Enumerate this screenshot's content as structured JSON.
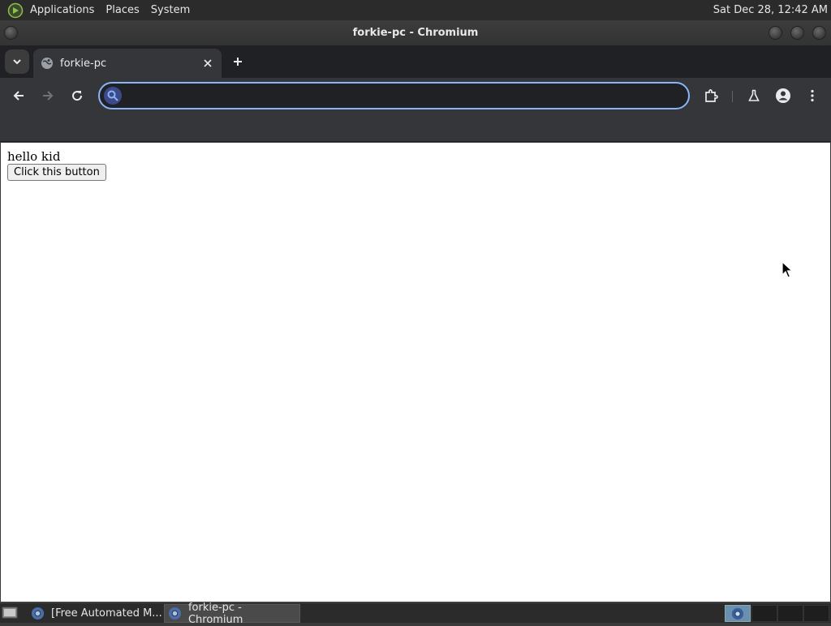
{
  "top_panel": {
    "menus": [
      "Applications",
      "Places",
      "System"
    ],
    "clock": "Sat Dec 28, 12:42 AM"
  },
  "window": {
    "title": "forkie-pc - Chromium"
  },
  "tabs": [
    {
      "title": "forkie-pc",
      "favicon": "globe-icon"
    }
  ],
  "toolbar": {
    "omnibox_value": "",
    "icons": [
      "back-icon",
      "forward-icon",
      "reload-icon",
      "extensions-icon",
      "labs-icon",
      "profile-icon",
      "menu-icon"
    ]
  },
  "page": {
    "greeting": "hello kid",
    "button_label": "Click this button"
  },
  "taskbar": {
    "tasks": [
      {
        "label": "[Free Automated M...",
        "icon": "chromium-icon",
        "active": false
      },
      {
        "label": "forkie-pc - Chromium",
        "icon": "chromium-icon",
        "active": true
      }
    ]
  },
  "colors": {
    "accent": "#8ab4f8",
    "toolbar": "#35363a",
    "tabstrip": "#202124"
  }
}
